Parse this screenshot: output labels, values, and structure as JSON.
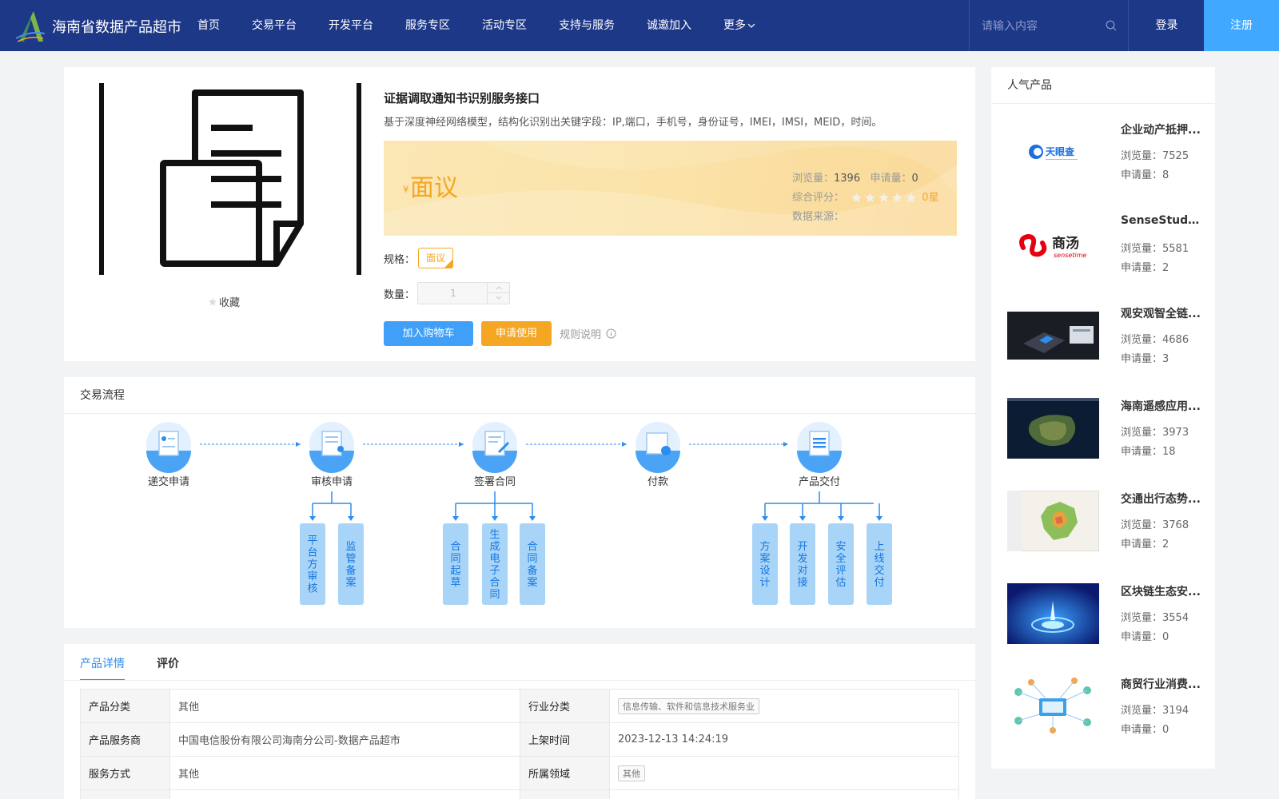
{
  "header": {
    "brand": "海南省数据产品超市",
    "nav": [
      "首页",
      "交易平台",
      "开发平台",
      "服务专区",
      "活动专区",
      "支持与服务",
      "诚邀加入"
    ],
    "more": "更多",
    "search_placeholder": "请输入内容",
    "login": "登录",
    "register": "注册"
  },
  "product": {
    "title": "证据调取通知书识别服务接口",
    "desc": "基于深度神经网络模型，结构化识别出关键字段：IP,端口，手机号，身份证号，IMEI，IMSI，MEID，时间。",
    "currency": "¥",
    "price": "面议",
    "views_label": "浏览量：",
    "views": "1396",
    "apply_label": "申请量：",
    "apply": "0",
    "rating_label": "综合评分：",
    "rating_value": 0,
    "rating_text": "0星",
    "source_label": "数据来源：",
    "favorite": "收藏",
    "spec_label": "规格：",
    "spec_option": "面议",
    "qty_label": "数量：",
    "qty_value": "1",
    "add_cart": "加入购物车",
    "apply_use": "申请使用",
    "rules": "规则说明"
  },
  "flow": {
    "title": "交易流程",
    "steps": [
      "递交申请",
      "审核申请",
      "签署合同",
      "付款",
      "产品交付"
    ],
    "sub_review": [
      "平台方审核",
      "监管备案"
    ],
    "sub_sign": [
      "合同起草",
      "生成电子合同",
      "合同备案"
    ],
    "sub_deliver": [
      "方案设计",
      "开发对接",
      "安全评估",
      "上线交付"
    ]
  },
  "tabs": [
    "产品详情",
    "评价"
  ],
  "details": [
    {
      "k1": "产品分类",
      "v1": "其他",
      "k2": "行业分类",
      "v2": "信息传输、软件和信息技术服务业"
    },
    {
      "k1": "产品服务商",
      "v1": "中国电信股份有限公司海南分公司-数据产品超市",
      "k2": "上架时间",
      "v2": "2023-12-13 14:24:19"
    },
    {
      "k1": "服务方式",
      "v1": "其他",
      "k2": "所属领域",
      "v2": "其他"
    }
  ],
  "sidebar": {
    "title": "人气产品",
    "views_label": "浏览量：",
    "apply_label": "申请量：",
    "items": [
      {
        "name": "企业动产抵押...",
        "views": "7525",
        "apply": "8",
        "thumb_text": "天眼查"
      },
      {
        "name": "SenseStudio...",
        "views": "5581",
        "apply": "2",
        "thumb_text": "商汤",
        "thumb_sub": "sensetime"
      },
      {
        "name": "观安观智全链...",
        "views": "4686",
        "apply": "3"
      },
      {
        "name": "海南遥感应用...",
        "views": "3973",
        "apply": "18"
      },
      {
        "name": "交通出行态势...",
        "views": "3768",
        "apply": "2"
      },
      {
        "name": "区块链生态安...",
        "views": "3554",
        "apply": "0"
      },
      {
        "name": "商贸行业消费...",
        "views": "3194",
        "apply": "0"
      }
    ]
  },
  "colors": {
    "primary": "#1e3888",
    "accent": "#40a9ff",
    "orange": "#f5a623",
    "flow_blue": "#2d8cf0"
  }
}
